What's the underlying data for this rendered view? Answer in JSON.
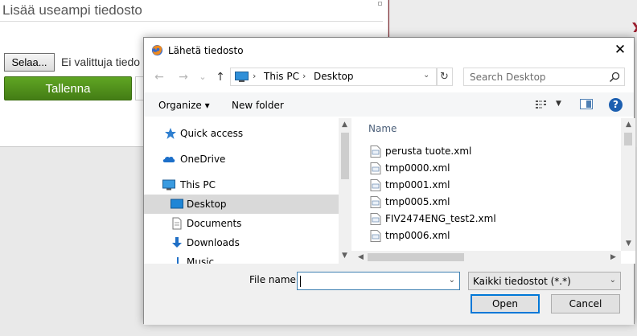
{
  "page": {
    "title": "Lisää useampi tiedosto",
    "browse_label": "Selaa...",
    "no_file_text": "Ei valittuja tiedo",
    "save_label": "Tallenna"
  },
  "dialog": {
    "title": "Lähetä tiedosto",
    "close_glyph": "✕",
    "nav": {
      "back": "←",
      "forward": "→",
      "recent": "⌄",
      "up": "↑"
    },
    "address": {
      "sep": "›",
      "pc": "This PC",
      "folder": "Desktop",
      "dropdown": "⌄",
      "refresh": "↻"
    },
    "search_placeholder": "Search Desktop",
    "toolbar": {
      "organize": "Organize ▾",
      "new_folder": "New folder",
      "view_dropdown": "▼",
      "help": "?"
    },
    "nav_items": [
      {
        "label": "Quick access",
        "icon": "star-icon"
      },
      {
        "label": "OneDrive",
        "icon": "cloud-icon"
      },
      {
        "label": "This PC",
        "icon": "computer-icon"
      },
      {
        "label": "Desktop",
        "icon": "desktop-icon",
        "selected": true
      },
      {
        "label": "Documents",
        "icon": "document-icon"
      },
      {
        "label": "Downloads",
        "icon": "download-icon"
      },
      {
        "label": "Music",
        "icon": "music-icon"
      }
    ],
    "files_header": "Name",
    "files": [
      "perusta tuote.xml",
      "tmp0000.xml",
      "tmp0001.xml",
      "tmp0005.xml",
      "FIV2474ENG_test2.xml",
      "tmp0006.xml"
    ],
    "file_name_label": "File name:",
    "file_name_value": "",
    "file_type": "Kaikki tiedostot (*.*)",
    "open_label": "Open",
    "cancel_label": "Cancel",
    "scroll": {
      "up": "▲",
      "down": "▼",
      "left": "◀",
      "right": "▶"
    }
  },
  "colors": {
    "save_green": "#4f8e1a",
    "selection": "#d9d9d9",
    "accent": "#0078d7",
    "page_bg": "#8c2a33"
  }
}
